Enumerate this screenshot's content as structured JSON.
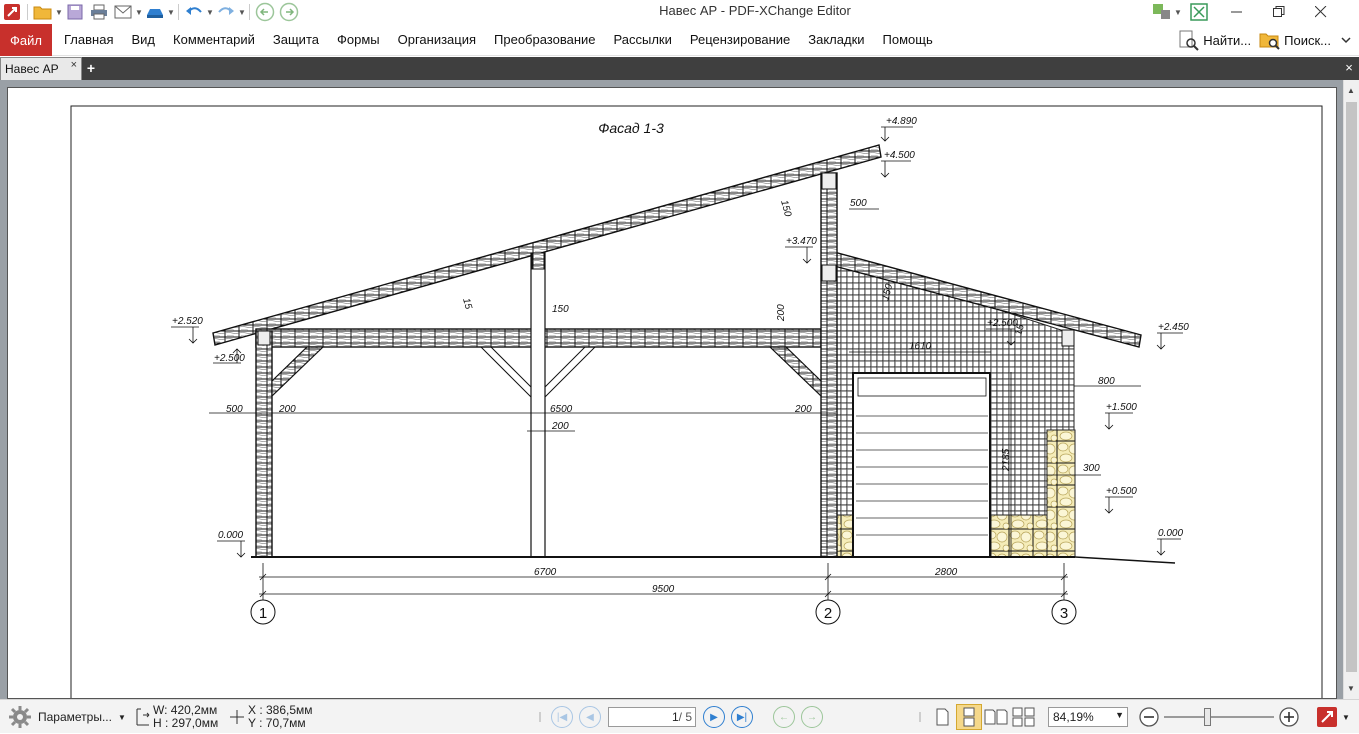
{
  "window": {
    "title": "Навес АР - PDF-XChange Editor"
  },
  "menu": {
    "file": "Файл",
    "items": [
      "Главная",
      "Вид",
      "Комментарий",
      "Защита",
      "Формы",
      "Организация",
      "Преобразование",
      "Рассылки",
      "Рецензирование",
      "Закладки",
      "Помощь"
    ],
    "find": "Найти...",
    "search": "Поиск..."
  },
  "tabs": {
    "active": "Навес АР"
  },
  "drawing": {
    "title": "Фасад 1-3",
    "elevations": {
      "e4890": "+4.890",
      "e4500": "+4.500",
      "e3470": "+3.470",
      "e2520": "+2.520",
      "e2500_left": "+2.500",
      "e2500_right": "+2.500",
      "e2450": "+2.450",
      "e1500": "+1.500",
      "e0500": "+0.500",
      "e0000_left": "0.000",
      "e0000_right": "0.000"
    },
    "dims": {
      "d500_top": "500",
      "d150_main": "150",
      "d15_main": "15",
      "d150_post": "150",
      "d200_vert": "200",
      "d150_right": "150",
      "d15_right": "15",
      "d1610": "1610",
      "d800": "800",
      "d500_left": "500",
      "d200_a": "200",
      "d6500": "6500",
      "d200_b": "200",
      "d200_c": "200",
      "d2185": "2185",
      "d300": "300",
      "d6700": "6700",
      "d2800": "2800",
      "d9500": "9500"
    },
    "axes": [
      "1",
      "2",
      "3"
    ]
  },
  "status": {
    "params": "Параметры...",
    "width": "W: 420,2мм",
    "height": "H : 297,0мм",
    "x": "X : 386,5мм",
    "y": "Y :   70,7мм",
    "page_current": "1",
    "page_total": "/ 5",
    "zoom": "84,19%"
  },
  "colors": {
    "file_red": "#c8302c",
    "nav_blue": "#2f7fd0",
    "tabbar_dark": "#3f3f3f",
    "viewport_gray": "#9aa0a6"
  }
}
